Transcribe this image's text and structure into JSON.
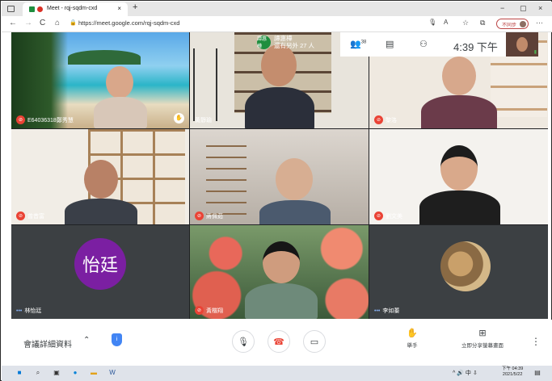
{
  "browser": {
    "tab_title": "Meet - rqj-sqdm-cxd",
    "tab_close": "×",
    "new_tab": "+",
    "window_controls": [
      "−",
      "▢",
      "×"
    ],
    "url": "https://meet.google.com/rqj-sqdm-cxd",
    "profile_label": "不同步",
    "nav_icons": [
      "←",
      "→",
      "C",
      "⌂"
    ],
    "menu": "···"
  },
  "meeting": {
    "host_initials": "譚惠樺",
    "host_name": "譚惠樺",
    "others_text": "還有另外 27 人",
    "people_count": "38",
    "time": "4:39 下午",
    "participants": [
      {
        "name": "E64036318鄭秀慧",
        "muted": true
      },
      {
        "name": "黃靜瑜",
        "muted": false
      },
      {
        "name": "黎洛",
        "muted": true
      },
      {
        "name": "曾昔富",
        "muted": true
      },
      {
        "name": "蔣佩茹",
        "muted": true
      },
      {
        "name": "劉文美",
        "muted": true
      },
      {
        "name": "林怡廷",
        "muted": false,
        "avatar_text": "怡廷"
      },
      {
        "name": "黃楷翔",
        "muted": true
      },
      {
        "name": "李如蓁",
        "muted": false
      }
    ]
  },
  "controls": {
    "meeting_details": "會議詳細資料",
    "raise_hand": "舉手",
    "present_now": "立即分享螢幕畫面",
    "more": "⋮"
  },
  "taskbar": {
    "tray_text": "^ 🔊 中 ⇩",
    "time": "下午 04:39",
    "date": "2021/5/22"
  },
  "colors": {
    "mute_red": "#ea4335",
    "grid_bg": "#202124",
    "avatar_purple": "#7b1fa2"
  }
}
